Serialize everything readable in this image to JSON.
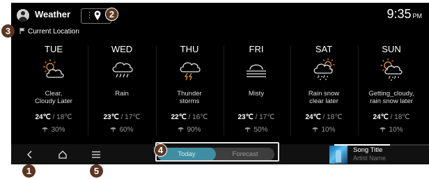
{
  "app": {
    "title": "Weather",
    "clock": "9:35",
    "ampm": "PM"
  },
  "location": {
    "label": "Current Location"
  },
  "days": [
    {
      "name": "TUE",
      "icon": "sun-cloud-icon",
      "desc_line1": "Clear,",
      "desc_line2": "Cloudy Later",
      "high": "24℃",
      "low": "18℃",
      "precip": "30%"
    },
    {
      "name": "WED",
      "icon": "rain-icon",
      "desc_line1": "Rain",
      "desc_line2": "",
      "high": "23℃",
      "low": "17℃",
      "precip": "60%"
    },
    {
      "name": "THU",
      "icon": "thunderstorm-icon",
      "desc_line1": "Thunder",
      "desc_line2": "storms",
      "high": "22℃",
      "low": "16℃",
      "precip": "90%"
    },
    {
      "name": "FRI",
      "icon": "mist-icon",
      "desc_line1": "Misty",
      "desc_line2": "",
      "high": "23℃",
      "low": "17℃",
      "precip": "50%"
    },
    {
      "name": "SAT",
      "icon": "sun-rain-snow-icon",
      "desc_line1": "Rain snow",
      "desc_line2": "clear later",
      "high": "24℃",
      "low": "18℃",
      "precip": "10%"
    },
    {
      "name": "SUN",
      "icon": "sun-rain-snow-icon",
      "desc_line1": "Getting_cloudy,",
      "desc_line2": "rain snow later",
      "high": "24℃",
      "low": "18℃",
      "precip": "10%"
    }
  ],
  "temp_separator": "/",
  "toggle": {
    "today_label": "Today",
    "forecast_label": "Forecast",
    "selected": "Today"
  },
  "media": {
    "song_title": "Song Title",
    "artist": "Artist Name"
  },
  "callouts": {
    "back": "1",
    "location_button": "2",
    "current_location": "3",
    "view_toggle": "4",
    "menu": "5"
  },
  "colors": {
    "accent": "#3f8ea1",
    "callout": "#5a3620",
    "weather_icon_sun": "#e89a30"
  }
}
